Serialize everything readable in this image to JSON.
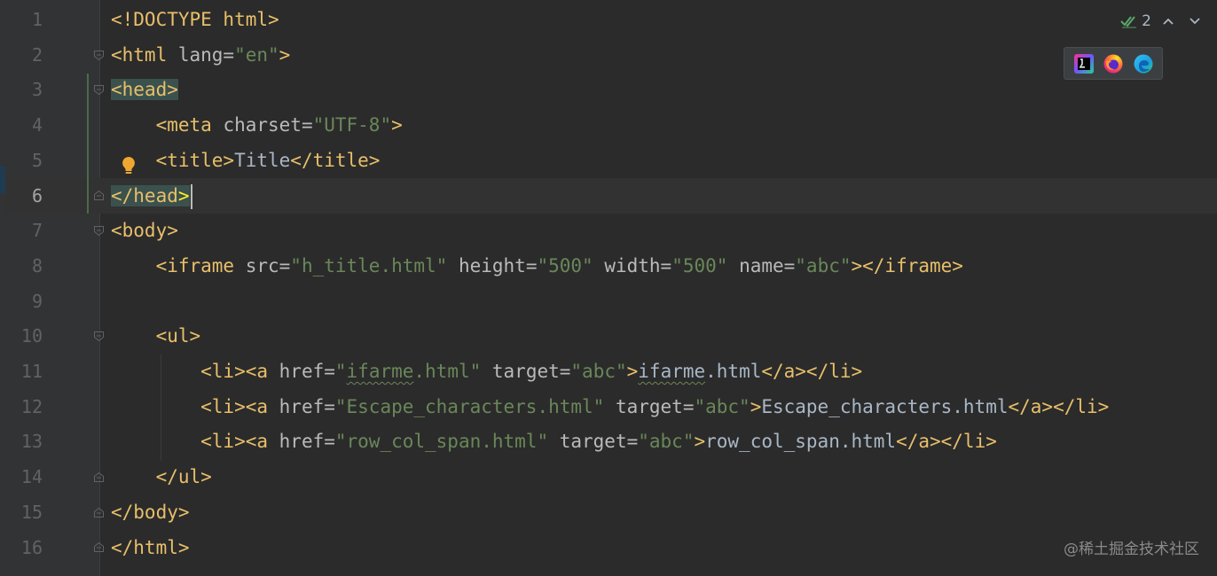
{
  "editor": {
    "lines": [
      {
        "n": "1",
        "tokens": [
          {
            "c": "tag",
            "t": "<!DOCTYPE html>"
          }
        ]
      },
      {
        "n": "2",
        "tokens": [
          {
            "c": "tag",
            "t": "<html "
          },
          {
            "c": "attr",
            "t": "lang="
          },
          {
            "c": "str",
            "t": "\"en\""
          },
          {
            "c": "tag",
            "t": ">"
          }
        ]
      },
      {
        "n": "3",
        "tokens": [
          {
            "c": "tag hl-tag",
            "t": "<"
          },
          {
            "c": "tag hl-tag",
            "t": "head"
          },
          {
            "c": "tag hl-tag",
            "t": ">"
          }
        ]
      },
      {
        "n": "4",
        "tokens": [
          {
            "c": "tag",
            "t": "    <meta "
          },
          {
            "c": "attr",
            "t": "charset="
          },
          {
            "c": "str",
            "t": "\"UTF-8\""
          },
          {
            "c": "tag",
            "t": ">"
          }
        ]
      },
      {
        "n": "5",
        "tokens": [
          {
            "c": "tag",
            "t": "    <title>"
          },
          {
            "c": "txt",
            "t": "Title"
          },
          {
            "c": "tag",
            "t": "</title>"
          }
        ]
      },
      {
        "n": "6",
        "tokens": [
          {
            "c": "tag hl-tag",
            "t": "</head"
          },
          {
            "c": "tag hl-tag hl-bracket",
            "t": ">"
          }
        ]
      },
      {
        "n": "7",
        "tokens": [
          {
            "c": "tag",
            "t": "<body>"
          }
        ]
      },
      {
        "n": "8",
        "tokens": [
          {
            "c": "tag",
            "t": "    <iframe "
          },
          {
            "c": "attr",
            "t": "src="
          },
          {
            "c": "str",
            "t": "\"h_title.html\""
          },
          {
            "c": "attr",
            "t": " height="
          },
          {
            "c": "str",
            "t": "\"500\""
          },
          {
            "c": "attr",
            "t": " width="
          },
          {
            "c": "str",
            "t": "\"500\""
          },
          {
            "c": "attr",
            "t": " name="
          },
          {
            "c": "str",
            "t": "\"abc\""
          },
          {
            "c": "tag",
            "t": "></iframe>"
          }
        ]
      },
      {
        "n": "9",
        "tokens": []
      },
      {
        "n": "10",
        "tokens": [
          {
            "c": "tag",
            "t": "    <ul>"
          }
        ]
      },
      {
        "n": "11",
        "tokens": [
          {
            "c": "tag",
            "t": "        <li><a "
          },
          {
            "c": "attr",
            "t": "href="
          },
          {
            "c": "str",
            "t": "\""
          },
          {
            "c": "str typo",
            "t": "ifarme"
          },
          {
            "c": "str",
            "t": ".html\""
          },
          {
            "c": "attr",
            "t": " target="
          },
          {
            "c": "str",
            "t": "\"abc\""
          },
          {
            "c": "tag",
            "t": ">"
          },
          {
            "c": "txt typo",
            "t": "ifarme"
          },
          {
            "c": "txt",
            "t": ".html"
          },
          {
            "c": "tag",
            "t": "</a></li>"
          }
        ]
      },
      {
        "n": "12",
        "tokens": [
          {
            "c": "tag",
            "t": "        <li><a "
          },
          {
            "c": "attr",
            "t": "href="
          },
          {
            "c": "str",
            "t": "\"Escape_characters.html\""
          },
          {
            "c": "attr",
            "t": " target="
          },
          {
            "c": "str",
            "t": "\"abc\""
          },
          {
            "c": "tag",
            "t": ">"
          },
          {
            "c": "txt",
            "t": "Escape_characters.html"
          },
          {
            "c": "tag",
            "t": "</a></li>"
          }
        ]
      },
      {
        "n": "13",
        "tokens": [
          {
            "c": "tag",
            "t": "        <li><a "
          },
          {
            "c": "attr",
            "t": "href="
          },
          {
            "c": "str",
            "t": "\"row_col_span.html\""
          },
          {
            "c": "attr",
            "t": " target="
          },
          {
            "c": "str",
            "t": "\"abc\""
          },
          {
            "c": "tag",
            "t": ">"
          },
          {
            "c": "txt",
            "t": "row_col_span.html"
          },
          {
            "c": "tag",
            "t": "</a></li>"
          }
        ]
      },
      {
        "n": "14",
        "tokens": [
          {
            "c": "tag",
            "t": "    </ul>"
          }
        ]
      },
      {
        "n": "15",
        "tokens": [
          {
            "c": "tag",
            "t": "</body>"
          }
        ]
      },
      {
        "n": "16",
        "tokens": [
          {
            "c": "tag",
            "t": "</html>"
          }
        ]
      }
    ],
    "current_line": "6"
  },
  "inspection": {
    "count": "2",
    "up_arrow": "^",
    "down_arrow": "v"
  },
  "browsers": [
    "intellij-browser-icon",
    "firefox-icon",
    "edge-icon"
  ],
  "watermark": "@稀土掘金技术社区",
  "colors": {
    "background": "#2b2b2b",
    "gutter": "#313335",
    "tag": "#e8bf6a",
    "attribute": "#bababa",
    "string": "#6a8759",
    "text": "#a9b7c6",
    "line_number": "#606366"
  }
}
